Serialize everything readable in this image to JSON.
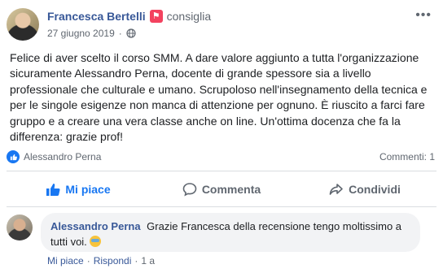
{
  "post": {
    "author": "Francesca Bertelli",
    "badge_icon": "recommend-flag-icon",
    "verb": "consiglia",
    "date": "27 giugno 2019",
    "separator": "·",
    "privacy_icon": "globe-icon",
    "more_icon": "more-options-icon",
    "text": "Felice di aver scelto il corso SMM. A dare valore aggiunto a tutta l'organizzazione sicuramente Alessandro Perna, docente di grande spessore sia a livello professionale che culturale e umano. Scrupoloso nell'insegnamento della tecnica e per le singole esigenze non manca di attenzione per ognuno. È riuscito a farci fare gruppo e a creare una vera classe anche on line. Un'ottima docenza che fa la differenza: grazie prof!"
  },
  "stats": {
    "reaction_name": "Alessandro Perna",
    "comments": "Commenti: 1"
  },
  "actions": {
    "like": "Mi piace",
    "comment": "Commenta",
    "share": "Condividi"
  },
  "comment": {
    "author": "Alessandro Perna",
    "text": "Grazie Francesca della recensione tengo moltissimo a tutti voi.",
    "like": "Mi piace",
    "reply": "Rispondi",
    "separator": "·",
    "time": "1 a"
  },
  "colors": {
    "link": "#385898",
    "accent": "#1877f2",
    "badge": "#f3425f",
    "muted": "#606770"
  }
}
